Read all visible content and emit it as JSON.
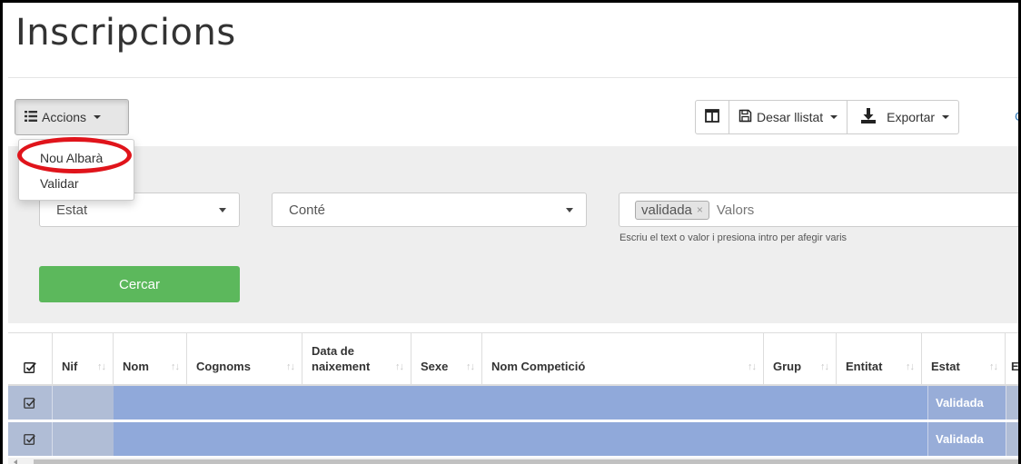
{
  "page": {
    "title": "Inscripcions"
  },
  "toolbar": {
    "actions_label": "Accions",
    "save_list_label": "Desar llistat",
    "export_label": "Exportar",
    "partial_link": "C"
  },
  "actions_menu": {
    "items": [
      {
        "label": "Nou Albarà",
        "highlighted": true
      },
      {
        "label": "Validar"
      }
    ],
    "highlight_color": "#e0141b"
  },
  "filters": {
    "field_select": "Estat",
    "operator_select": "Conté",
    "value_tags": [
      "validada"
    ],
    "value_placeholder": "Valors",
    "help_text": "Escriu el text o valor i presiona intro per afegir varis",
    "search_label": "Cercar"
  },
  "table": {
    "columns": [
      {
        "label": ""
      },
      {
        "label": "Nif"
      },
      {
        "label": "Nom"
      },
      {
        "label": "Cognoms"
      },
      {
        "label_line1": "Data de",
        "label_line2": "naixement"
      },
      {
        "label": "Sexe"
      },
      {
        "label": "Nom Competició"
      },
      {
        "label": "Grup"
      },
      {
        "label": "Entitat"
      },
      {
        "label": "Estat"
      },
      {
        "label": "En"
      }
    ],
    "rows": [
      {
        "selected": true,
        "estat": "Validada"
      },
      {
        "selected": true,
        "estat": "Validada"
      }
    ]
  },
  "colors": {
    "accent_green": "#5cb85c",
    "selected_row": "#90a9da",
    "panel_gray": "#eeeeee"
  }
}
